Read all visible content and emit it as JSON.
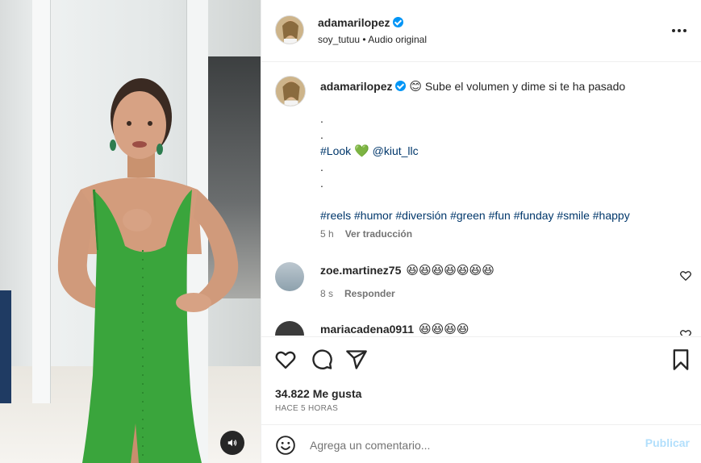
{
  "post": {
    "author": "adamarilopez",
    "audio_user": "soy_tutuu",
    "audio_sep": " • ",
    "audio_label": "Audio original",
    "more_icon": "more-horizontal-icon"
  },
  "caption": {
    "author": "adamarilopez",
    "emoji": "😊",
    "text": "Sube el volumen y dime si te ha pasado",
    "dot1": ".",
    "dot2": ".",
    "look_tag": "#Look",
    "heart": "💚",
    "mention": "@kiut_llc",
    "dot3": ".",
    "dot4": ".",
    "hashtags": "#reels #humor #diversión #green #fun #funday #smile #happy",
    "age": "5 h",
    "translate": "Ver traducción"
  },
  "comments": [
    {
      "user": "zoe.martinez75",
      "text": "😆😆😆😆😆😆😆",
      "age": "8 s",
      "reply": "Responder"
    },
    {
      "user": "mariacadena0911",
      "text": "😆😆😆😆"
    }
  ],
  "actions": {
    "likes": "34.822 Me gusta",
    "timestamp": "HACE 5 HORAS",
    "icons": [
      "heart-icon",
      "comment-icon",
      "share-icon",
      "bookmark-icon"
    ]
  },
  "composer": {
    "placeholder": "Agrega un comentario...",
    "publish": "Publicar"
  },
  "colors": {
    "link": "#00376b",
    "verified": "#0095f6",
    "publish_disabled": "#b2dffc",
    "dress": "#3aa53c"
  }
}
